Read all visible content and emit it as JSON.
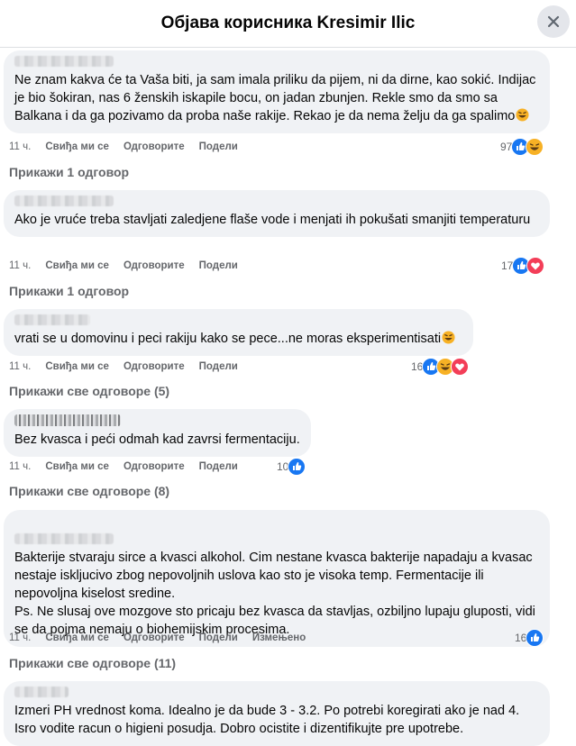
{
  "header": {
    "title": "Објава корисника Kresimir Ilic"
  },
  "labels": {
    "like": "Свиђа ми се",
    "reply": "Одговорите",
    "share": "Подели",
    "edited": "Измењено"
  },
  "comments": [
    {
      "text": "Ne znam kakva će ta Vaša biti, ja sam imala priliku da pijem, ni da dirne, kao sokić. Indijac je bio šokiran, nas 6 ženskih iskapile bocu, on jadan zbunjen. Rekle smo da smo sa Balkana i da ga pozivamo da proba naše rakije. Rekao je da nema želju da ga spalimo",
      "time": "11 ч.",
      "reaction_count": "97",
      "reactions": [
        "like",
        "haha"
      ],
      "replies": "Прикажи 1 одговор",
      "trailing_emoji": "laugh-emoji"
    },
    {
      "text": "Ako je vruće treba stavljati zaledjene flaše vode i menjati ih pokušati smanjiti temperaturu",
      "time": "11 ч.",
      "reaction_count": "17",
      "reactions": [
        "like",
        "love"
      ],
      "replies": "Прикажи 1 одговор"
    },
    {
      "text": "vrati se u domovinu i peci rakiju kako se pece...ne moras eksperimentisati",
      "time": "11 ч.",
      "reaction_count": "16",
      "reactions": [
        "like",
        "haha",
        "love"
      ],
      "replies": "Прикажи све одговоре (5)",
      "trailing_emoji": "laugh-emoji"
    },
    {
      "text": "Bez kvasca i peći odmah kad zavrsi fermentaciju.",
      "time": "11 ч.",
      "reaction_count": "10",
      "reactions": [
        "like"
      ],
      "replies": "Прикажи све одговоре (8)"
    },
    {
      "text": "Bakterije stvaraju sirce a kvasci alkohol. Cim nestane kvasca bakterije napadaju a kvasac nestaje iskljucivo zbog nepovoljnih uslova kao sto je visoka temp. Fermentacije ili nepovoljna kiselost sredine.\nPs. Ne slusaj ove mozgove sto pricaju bez kvasca da stavljas, ozbiljno lupaju gluposti, vidi se da pojma nemaju o biohemijskim procesima.",
      "time": "11 ч.",
      "reaction_count": "16",
      "reactions": [
        "like"
      ],
      "replies": "Прикажи све одговоре (11)",
      "edited": true
    },
    {
      "text": "Izmeri PH vrednost koma. Idealno je da bude 3 - 3.2. Po potrebi koregirati ako je nad 4. Isro vodite racun o higieni posudja. Dobro ocistite i dizentifikujte pre upotrebe.",
      "time": "",
      "reaction_count": "",
      "reactions": []
    }
  ],
  "colors": {
    "like": "#1877f2",
    "love": "#f33e58",
    "haha": "#f7b125",
    "bubble": "#f0f2f5",
    "meta": "#65676b"
  }
}
